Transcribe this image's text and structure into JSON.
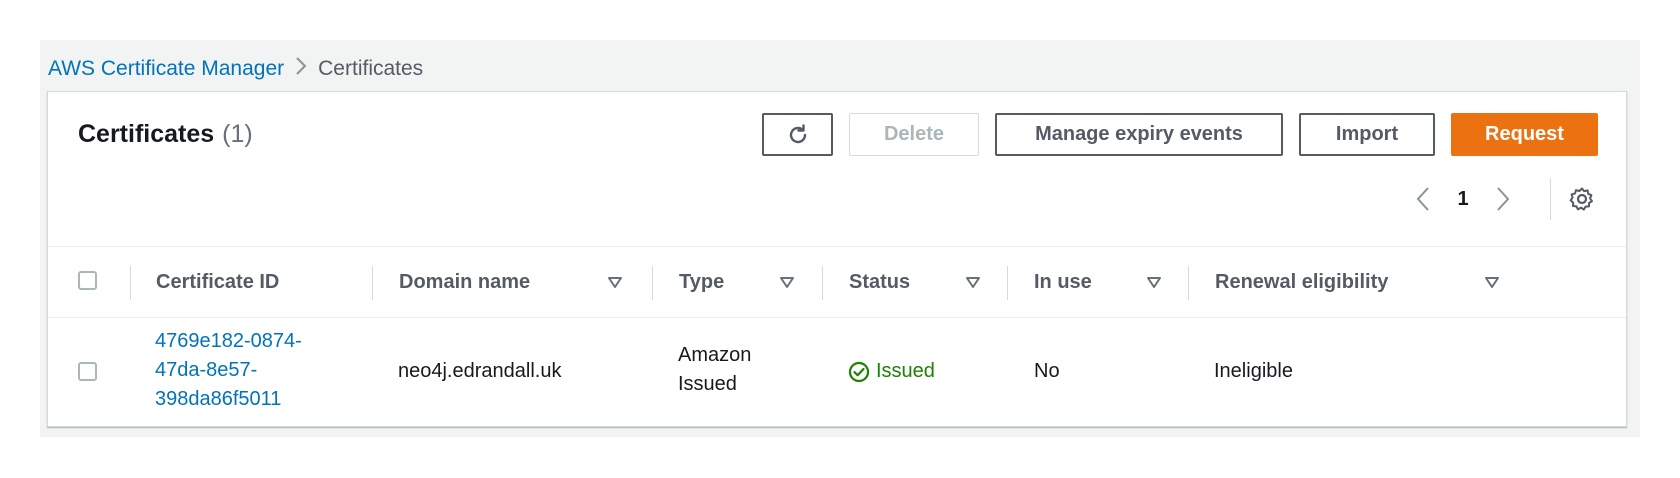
{
  "breadcrumb": {
    "root": "AWS Certificate Manager",
    "separator": ">",
    "current": "Certificates"
  },
  "panel": {
    "title": "Certificates",
    "count": "(1)"
  },
  "toolbar": {
    "refresh_icon": "refresh-icon",
    "delete_label": "Delete",
    "expiry_label": "Manage expiry events",
    "import_label": "Import",
    "request_label": "Request"
  },
  "pagination": {
    "current_page": "1"
  },
  "table": {
    "columns": [
      {
        "label": "Certificate ID",
        "sortable": false
      },
      {
        "label": "Domain name",
        "sortable": true
      },
      {
        "label": "Type",
        "sortable": true
      },
      {
        "label": "Status",
        "sortable": true
      },
      {
        "label": "In use",
        "sortable": true
      },
      {
        "label": "Renewal eligibility",
        "sortable": true
      }
    ],
    "rows": [
      {
        "certificate_id_lines": [
          "4769e182-0874-",
          "47da-8e57-",
          "398da86f5011"
        ],
        "domain_name": "neo4j.edrandall.uk",
        "type_lines": [
          "Amazon",
          "Issued"
        ],
        "status": "Issued",
        "in_use": "No",
        "renewal_eligibility": "Ineligible"
      }
    ]
  },
  "colors": {
    "link": "#0073bb",
    "primary_button": "#ec7211",
    "success": "#1d8102",
    "background": "#f2f3f3"
  }
}
